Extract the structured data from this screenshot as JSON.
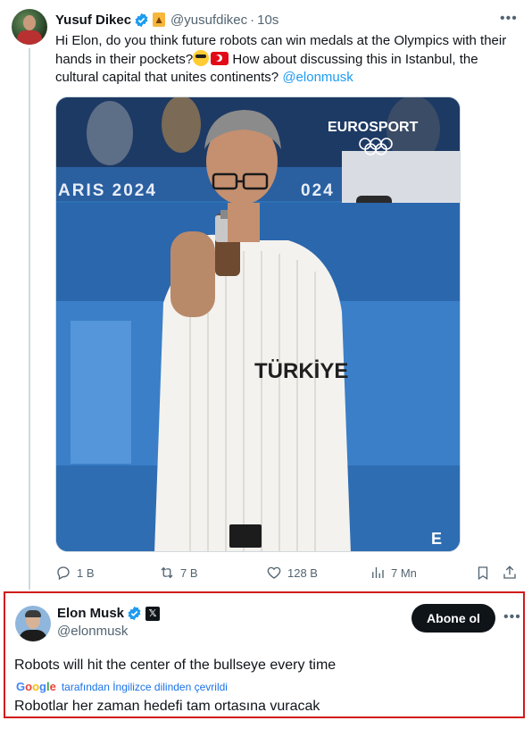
{
  "tweet": {
    "author_name": "Yusuf Dikec",
    "handle": "@yusufdikec",
    "separator": "·",
    "time": "10s",
    "text_before": "Hi Elon, do you think future robots can win medals at the Olympics with their hands in their pockets?",
    "text_after": " How about discussing this in Istanbul, the cultural capital that unites continents? ",
    "mention": "@elonmusk",
    "media": {
      "broadcaster": "EUROSPORT",
      "banner_text": "ARIS 2024",
      "banner_text_right": "024",
      "shirt_text": "TÜRKİYE"
    },
    "stats": {
      "replies": "1 B",
      "reposts": "7 B",
      "likes": "128 B",
      "views": "7 Mn"
    }
  },
  "reply": {
    "author_name": "Elon Musk",
    "handle": "@elonmusk",
    "subscribe_label": "Abone ol",
    "text": "Robots will hit the center of the bullseye every time",
    "translation_note": "tarafından İngilizce dilinden çevrildi",
    "translated_text": "Robotlar her zaman hedefi tam ortasına vuracak"
  },
  "icons": [
    "verified-icon",
    "torch-icon",
    "more-icon",
    "reply-icon",
    "repost-icon",
    "like-icon",
    "views-icon",
    "bookmark-icon",
    "share-icon",
    "x-badge-icon",
    "google-logo"
  ],
  "colors": {
    "accent": "#1d9bf0",
    "highlight_border": "#d01b1b",
    "secondary_text": "#536471"
  }
}
